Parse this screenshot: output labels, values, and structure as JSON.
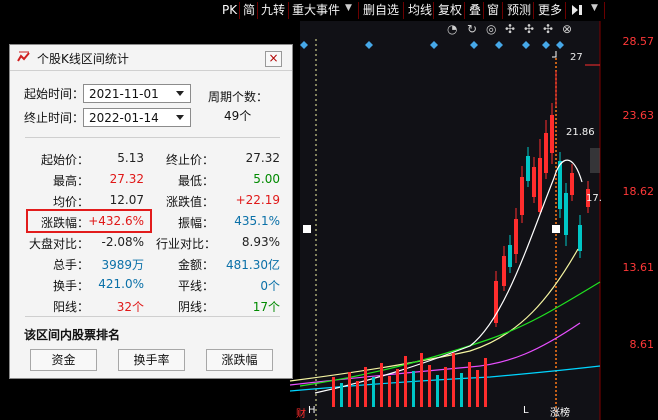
{
  "toolbar": {
    "items": [
      "PK",
      "简",
      "九转",
      "重大事件",
      "删自选",
      "均线",
      "复权",
      "叠",
      "窗",
      "预测",
      "更多"
    ]
  },
  "chart": {
    "price_labels": [
      "28.57",
      "23.63",
      "18.62",
      "13.61",
      "8.61"
    ],
    "high_label": "27",
    "ma_label": "21.86",
    "ma_label2": "17.",
    "limit_up_label": "涨榜",
    "bottom_markers": [
      "财",
      "H",
      "L"
    ],
    "colors": {
      "up": "#ff2d2d",
      "down": "#00c6c6",
      "grid": "#7f0000",
      "ma_yellow": "#f5f5a0",
      "ma_white": "#ffffff",
      "ma_magenta": "#d878ff",
      "ma_green": "#17d817",
      "ma_cyan": "#00d5ff"
    }
  },
  "dialog": {
    "title": "个股K线区间统计",
    "start_label": "起始时间：",
    "end_label": "终止时间：",
    "period_label": "周期个数：",
    "start_date": "2021-11-01",
    "end_date": "2022-01-14",
    "period_count": "49个",
    "rows": [
      {
        "k1": "起始价：",
        "v1": "5.13",
        "c1": "#222222",
        "k2": "终止价：",
        "v2": "27.32",
        "c2": "#222222"
      },
      {
        "k1": "最高：",
        "v1": "27.32",
        "c1": "#e01818",
        "k2": "最低：",
        "v2": "5.00",
        "c2": "#008a00"
      },
      {
        "k1": "均价：",
        "v1": "12.07",
        "c1": "#222222",
        "k2": "涨跌值：",
        "v2": "+22.19",
        "c2": "#e01818"
      },
      {
        "k1": "涨跌幅：",
        "v1": "+432.6%",
        "c1": "#e01818",
        "k2": "振幅：",
        "v2": "435.1%",
        "c2": "#0a70a8"
      },
      {
        "k1": "大盘对比：",
        "v1": "-2.08%",
        "c1": "#222222",
        "k2": "行业对比：",
        "v2": "8.93%",
        "c2": "#222222"
      },
      {
        "k1": "总手：",
        "v1": "3989万",
        "c1": "#0a70a8",
        "k2": "金额：",
        "v2": "481.30亿",
        "c2": "#0a70a8"
      },
      {
        "k1": "换手：",
        "v1": "421.0%",
        "c1": "#0a70a8",
        "k2": "平线：",
        "v2": "0个",
        "c2": "#0a70a8"
      },
      {
        "k1": "阳线：",
        "v1": "32个",
        "c1": "#e01818",
        "k2": "阴线：",
        "v2": "17个",
        "c2": "#008a00"
      }
    ],
    "section_title": "该区间内股票排名",
    "buttons": [
      "资金",
      "换手率",
      "涨跌幅"
    ]
  }
}
